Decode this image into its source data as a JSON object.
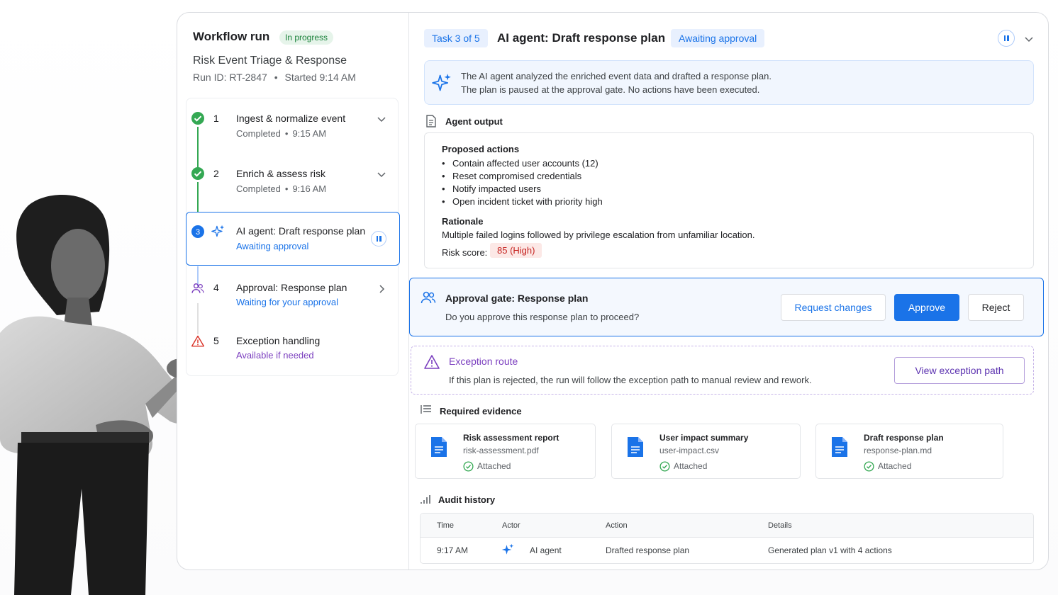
{
  "workflow": {
    "title": "Workflow run",
    "status": "In progress",
    "name": "Risk Event Triage & Response",
    "run_id": "Run ID: RT-2847",
    "started": "Started 9:14 AM",
    "separator": "•"
  },
  "steps": [
    {
      "num": "1",
      "title": "Ingest & normalize event",
      "status": "Completed",
      "time": "9:15 AM",
      "icon": "check-circle-icon"
    },
    {
      "num": "2",
      "title": "Enrich & assess risk",
      "status": "Completed",
      "time": "9:16 AM",
      "icon": "check-circle-icon"
    },
    {
      "num": "3",
      "title": "AI agent: Draft response plan",
      "status": "Awaiting approval",
      "icon": "sparkle-icon"
    },
    {
      "num": "4",
      "title": "Approval: Response plan",
      "status": "Waiting for your approval",
      "icon": "people-icon"
    },
    {
      "num": "5",
      "title": "Exception handling",
      "status": "Available if needed",
      "icon": "warning-icon"
    }
  ],
  "task": {
    "chip": "Task 3 of 5",
    "title": "AI agent: Draft response plan",
    "status": "Awaiting approval"
  },
  "info": {
    "line1": "The AI agent analyzed the enriched event data and drafted a response plan.",
    "line2": "The plan is paused at the approval gate. No actions have been executed."
  },
  "output": {
    "header": "Agent output",
    "proposed_title": "Proposed actions",
    "actions": [
      "Contain affected user accounts (12)",
      "Reset compromised credentials",
      "Notify impacted users",
      "Open incident ticket with priority high"
    ],
    "rationale_title": "Rationale",
    "rationale": "Multiple failed logins followed by privilege escalation from unfamiliar location.",
    "risk_label": "Risk score:",
    "risk_value": "85 (High)"
  },
  "gate": {
    "title": "Approval gate: Response plan",
    "question": "Do you approve this response plan to proceed?",
    "request_changes": "Request changes",
    "approve": "Approve",
    "reject": "Reject"
  },
  "exception": {
    "title": "Exception route",
    "text": "If this plan is rejected, the run will follow the exception path to manual review and rework.",
    "button": "View exception path"
  },
  "evidence": {
    "header": "Required evidence",
    "items": [
      {
        "name": "Risk assessment report",
        "file": "risk-assessment.pdf",
        "status": "Attached"
      },
      {
        "name": "User impact summary",
        "file": "user-impact.csv",
        "status": "Attached"
      },
      {
        "name": "Draft response plan",
        "file": "response-plan.md",
        "status": "Attached"
      }
    ]
  },
  "audit": {
    "header": "Audit history",
    "columns": [
      "Time",
      "Actor",
      "Action",
      "Details"
    ],
    "rows": [
      {
        "time": "9:17 AM",
        "actor": "AI agent",
        "action": "Drafted response plan",
        "details": "Generated plan v1 with 4 actions"
      }
    ]
  },
  "colors": {
    "accent": "#1a73e8",
    "success": "#34a853",
    "danger": "#d93025",
    "exception": "#7b3fbf"
  }
}
